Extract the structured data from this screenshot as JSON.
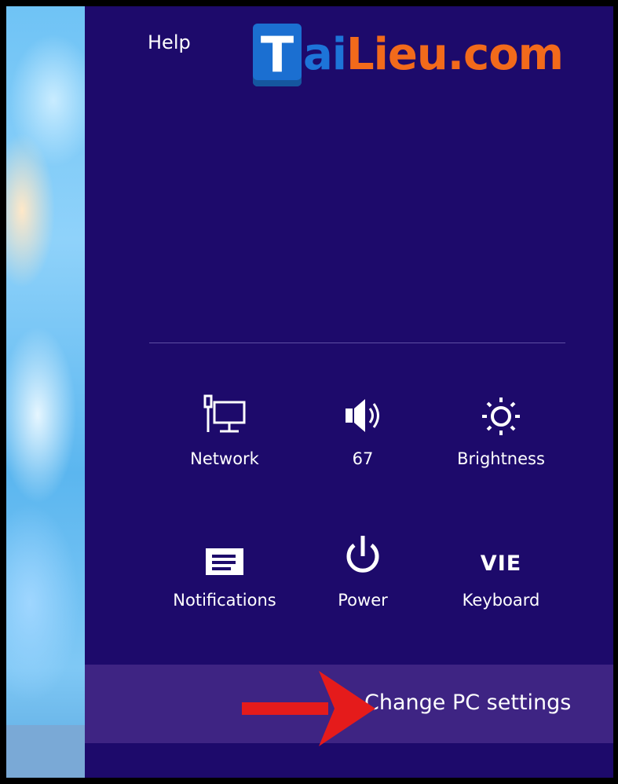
{
  "charm": {
    "help_label": "Help",
    "watermark": {
      "box_letter": "T",
      "part1": "ai",
      "part2": "Lieu",
      "part3": ".com"
    },
    "tiles": [
      {
        "id": "network",
        "label": "Network",
        "icon": "network-icon"
      },
      {
        "id": "volume",
        "label": "67",
        "icon": "speaker-icon"
      },
      {
        "id": "brightness",
        "label": "Brightness",
        "icon": "brightness-icon"
      },
      {
        "id": "notifications",
        "label": "Notifications",
        "icon": "notifications-icon"
      },
      {
        "id": "power",
        "label": "Power",
        "icon": "power-icon"
      },
      {
        "id": "keyboard",
        "label": "Keyboard",
        "icon_text": "VIE"
      }
    ],
    "change_settings_label": "Change PC settings"
  },
  "colors": {
    "charm_background": "#1d0a6b",
    "settings_bar": "#3e2483",
    "arrow": "#e51b1b",
    "logo_blue": "#1d74d8",
    "logo_orange": "#f26a1b"
  }
}
